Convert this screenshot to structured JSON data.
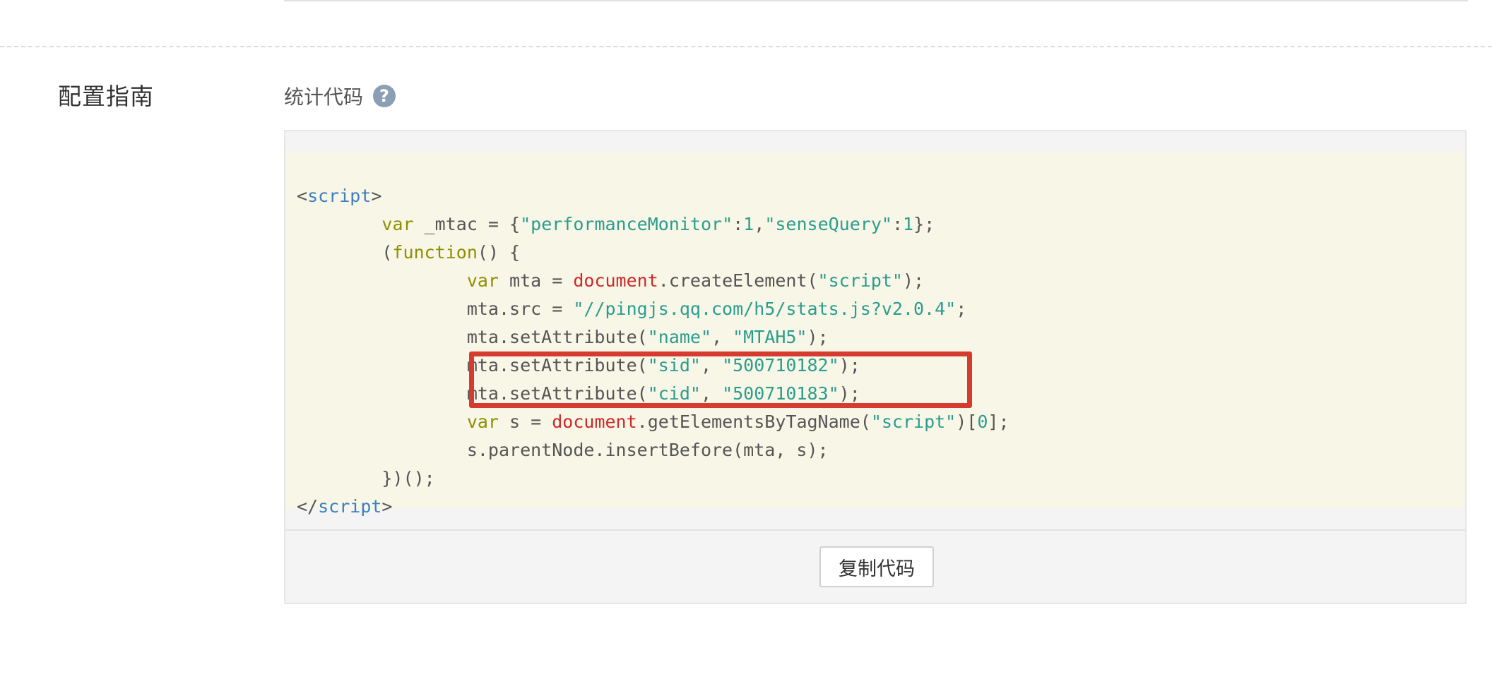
{
  "section": {
    "title": "配置指南"
  },
  "field": {
    "label": "统计代码",
    "help_icon": "question-circle-icon"
  },
  "code_lines": [
    [
      {
        "c": "p",
        "t": "<"
      },
      {
        "c": "t",
        "t": "script"
      },
      {
        "c": "p",
        "t": ">"
      }
    ],
    [
      {
        "c": "p",
        "t": "        "
      },
      {
        "c": "k",
        "t": "var"
      },
      {
        "c": "p",
        "t": " _mtac = {"
      },
      {
        "c": "s",
        "t": "\"performanceMonitor\""
      },
      {
        "c": "p",
        "t": ":"
      },
      {
        "c": "n",
        "t": "1"
      },
      {
        "c": "p",
        "t": ","
      },
      {
        "c": "s",
        "t": "\"senseQuery\""
      },
      {
        "c": "p",
        "t": ":"
      },
      {
        "c": "n",
        "t": "1"
      },
      {
        "c": "p",
        "t": "};"
      }
    ],
    [
      {
        "c": "p",
        "t": "        ("
      },
      {
        "c": "k",
        "t": "function"
      },
      {
        "c": "p",
        "t": "() {"
      }
    ],
    [
      {
        "c": "p",
        "t": "                "
      },
      {
        "c": "k",
        "t": "var"
      },
      {
        "c": "p",
        "t": " mta = "
      },
      {
        "c": "d",
        "t": "document"
      },
      {
        "c": "p",
        "t": ".createElement("
      },
      {
        "c": "s",
        "t": "\"script\""
      },
      {
        "c": "p",
        "t": ");"
      }
    ],
    [
      {
        "c": "p",
        "t": "                mta.src = "
      },
      {
        "c": "s",
        "t": "\"//pingjs.qq.com/h5/stats.js?v2.0.4\""
      },
      {
        "c": "p",
        "t": ";"
      }
    ],
    [
      {
        "c": "p",
        "t": "                mta.setAttribute("
      },
      {
        "c": "s",
        "t": "\"name\""
      },
      {
        "c": "p",
        "t": ", "
      },
      {
        "c": "s",
        "t": "\"MTAH5\""
      },
      {
        "c": "p",
        "t": ");"
      }
    ],
    [
      {
        "c": "p",
        "t": "                mta.setAttribute("
      },
      {
        "c": "s",
        "t": "\"sid\""
      },
      {
        "c": "p",
        "t": ", "
      },
      {
        "c": "s",
        "t": "\"500710182\""
      },
      {
        "c": "p",
        "t": ");"
      }
    ],
    [
      {
        "c": "p",
        "t": "                mta.setAttribute("
      },
      {
        "c": "s",
        "t": "\"cid\""
      },
      {
        "c": "p",
        "t": ", "
      },
      {
        "c": "s",
        "t": "\"500710183\""
      },
      {
        "c": "p",
        "t": ");"
      }
    ],
    [
      {
        "c": "p",
        "t": "                "
      },
      {
        "c": "k",
        "t": "var"
      },
      {
        "c": "p",
        "t": " s = "
      },
      {
        "c": "d",
        "t": "document"
      },
      {
        "c": "p",
        "t": ".getElementsByTagName("
      },
      {
        "c": "s",
        "t": "\"script\""
      },
      {
        "c": "p",
        "t": ")["
      },
      {
        "c": "n",
        "t": "0"
      },
      {
        "c": "p",
        "t": "];"
      }
    ],
    [
      {
        "c": "p",
        "t": "                s.parentNode.insertBefore(mta, s);"
      }
    ],
    [
      {
        "c": "p",
        "t": "        })();"
      }
    ],
    [
      {
        "c": "p",
        "t": "</"
      },
      {
        "c": "t",
        "t": "script"
      },
      {
        "c": "p",
        "t": ">"
      }
    ]
  ],
  "copy_button": {
    "label": "复制代码"
  },
  "colors": {
    "highlight_border": "#d63b2f",
    "code_background": "#f8f6e6",
    "keyword": "#8f8f00",
    "string": "#2a9d8f",
    "tag": "#3d7fc0",
    "builtin": "#cc2a2a"
  }
}
